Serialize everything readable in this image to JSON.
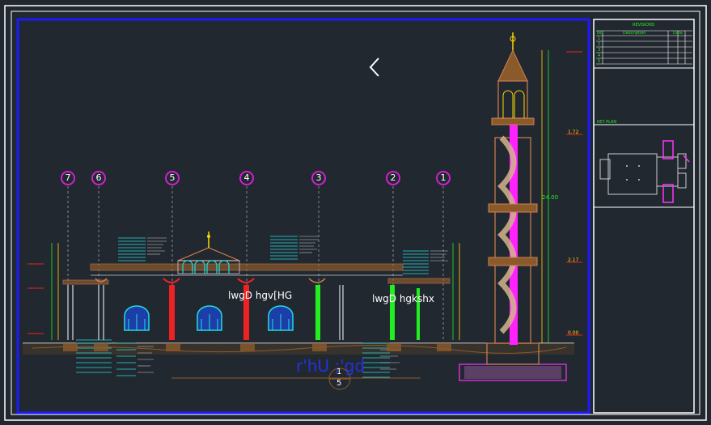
{
  "labels": {
    "left_section": "lwgD hgv[HG",
    "right_section": "lwgD hgkshx",
    "main_title": "r'hU ;'gd",
    "section_number_top": "1",
    "section_number_bottom": "5"
  },
  "grid_lines": [
    "7",
    "6",
    "5",
    "4",
    "3",
    "2",
    "1"
  ],
  "revisions": {
    "title": "REVISIONS",
    "columns": [
      "NO",
      "Description",
      "Date"
    ],
    "rows": [
      "1",
      "2",
      "3",
      "4",
      "5"
    ]
  },
  "key_plan_title": "KEY PLAN",
  "dimensions": {
    "tower_height": "24.00",
    "level_a": "2.17",
    "level_b": "1.72",
    "level_c": "0.00"
  },
  "colors": {
    "background": "#222830",
    "frame_blue": "#1a1aff",
    "magenta": "#ff33ff",
    "green": "#22ee22",
    "cyan": "#22dddd",
    "red": "#ee2222",
    "brown": "#8b5a2b"
  },
  "icons": {
    "nav": "chevron-left-icon"
  }
}
